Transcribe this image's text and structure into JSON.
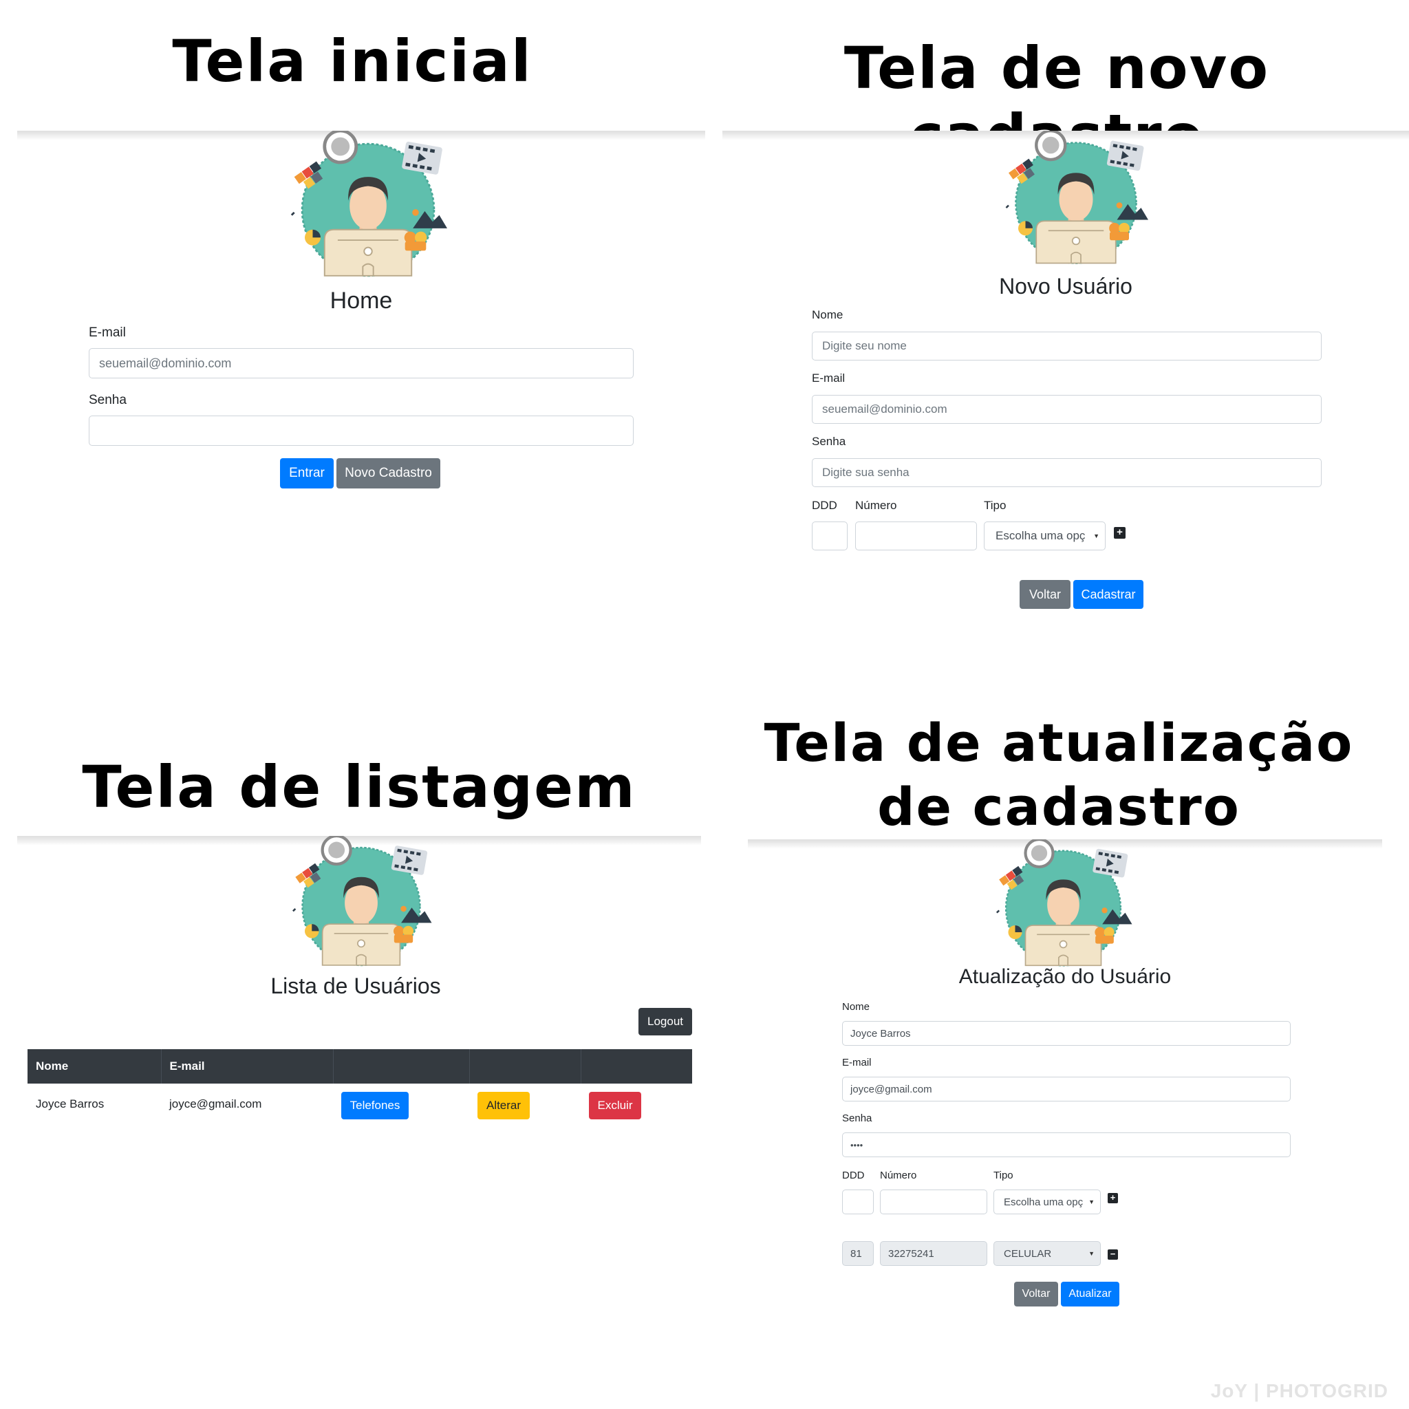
{
  "colors": {
    "primary": "#007bff",
    "secondary": "#6c757d",
    "dark": "#343a40",
    "warning": "#ffc107",
    "danger": "#dc3545"
  },
  "quadrants": {
    "home": {
      "heading": "Tela inicial",
      "title": "Home",
      "email_label": "E-mail",
      "email_placeholder": "seuemail@dominio.com",
      "password_label": "Senha",
      "password_value": "",
      "enter_button": "Entrar",
      "signup_button": "Novo Cadastro"
    },
    "signup": {
      "heading": "Tela de novo cadastro",
      "title": "Novo Usuário",
      "name_label": "Nome",
      "name_placeholder": "Digite seu nome",
      "email_label": "E-mail",
      "email_placeholder": "seuemail@dominio.com",
      "password_label": "Senha",
      "password_placeholder": "Digite sua senha",
      "ddd_label": "DDD",
      "number_label": "Número",
      "type_label": "Tipo",
      "type_select": "Escolha uma opç",
      "add_icon": "plus-square-icon",
      "back_button": "Voltar",
      "submit_button": "Cadastrar"
    },
    "list": {
      "heading": "Tela de listagem",
      "title": "Lista de Usuários",
      "logout_button": "Logout",
      "columns": [
        "Nome",
        "E-mail",
        "",
        "",
        ""
      ],
      "rows": [
        {
          "name": "Joyce Barros",
          "email": "joyce@gmail.com",
          "phones_button": "Telefones",
          "edit_button": "Alterar",
          "delete_button": "Excluir"
        }
      ]
    },
    "update": {
      "heading_line1": "Tela de atualização",
      "heading_line2": "de cadastro",
      "title": "Atualização do Usuário",
      "name_label": "Nome",
      "name_value": "Joyce Barros",
      "email_label": "E-mail",
      "email_value": "joyce@gmail.com",
      "password_label": "Senha",
      "password_value": "••••",
      "ddd_label": "DDD",
      "number_label": "Número",
      "type_label": "Tipo",
      "type_select": "Escolha uma opç",
      "add_icon": "plus-square-icon",
      "phone": {
        "ddd": "81",
        "number": "32275241",
        "type": "CELULAR"
      },
      "remove_icon": "minus-square-icon",
      "back_button": "Voltar",
      "submit_button": "Atualizar"
    }
  },
  "watermark": "JoY | PHOTOGRID"
}
